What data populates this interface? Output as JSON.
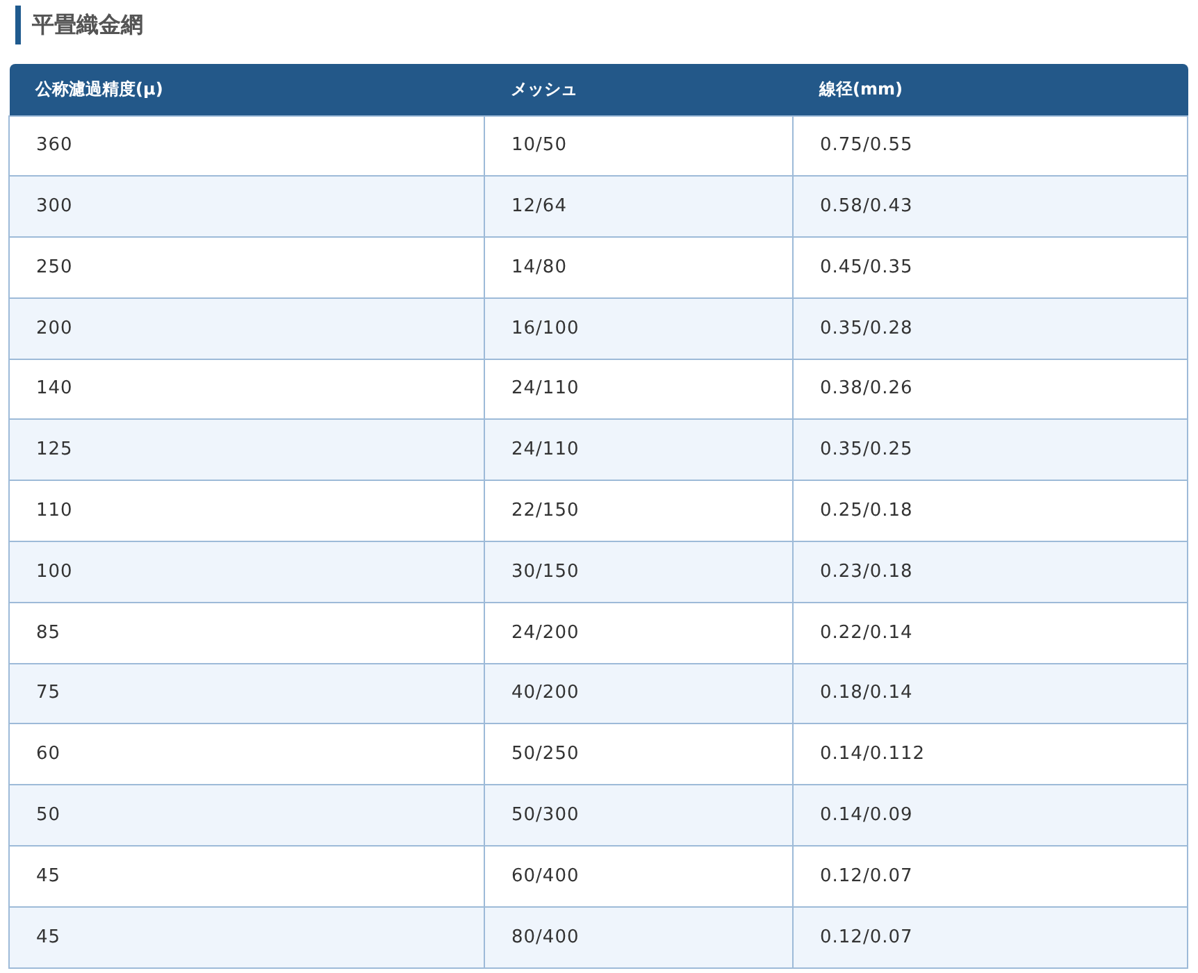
{
  "title": "平畳織金網",
  "table": {
    "columns": [
      "公称濾過精度(μ)",
      "メッシュ",
      "線径(mm)"
    ],
    "rows": [
      [
        "360",
        "10/50",
        "0.75/0.55"
      ],
      [
        "300",
        "12/64",
        "0.58/0.43"
      ],
      [
        "250",
        "14/80",
        "0.45/0.35"
      ],
      [
        "200",
        "16/100",
        "0.35/0.28"
      ],
      [
        "140",
        "24/110",
        "0.38/0.26"
      ],
      [
        "125",
        "24/110",
        "0.35/0.25"
      ],
      [
        "110",
        "22/150",
        "0.25/0.18"
      ],
      [
        "100",
        "30/150",
        "0.23/0.18"
      ],
      [
        "85",
        "24/200",
        "0.22/0.14"
      ],
      [
        "75",
        "40/200",
        "0.18/0.14"
      ],
      [
        "60",
        "50/250",
        "0.14/0.112"
      ],
      [
        "50",
        "50/300",
        "0.14/0.09"
      ],
      [
        "45",
        "60/400",
        "0.12/0.07"
      ],
      [
        "45",
        "80/400",
        "0.12/0.07"
      ]
    ]
  }
}
